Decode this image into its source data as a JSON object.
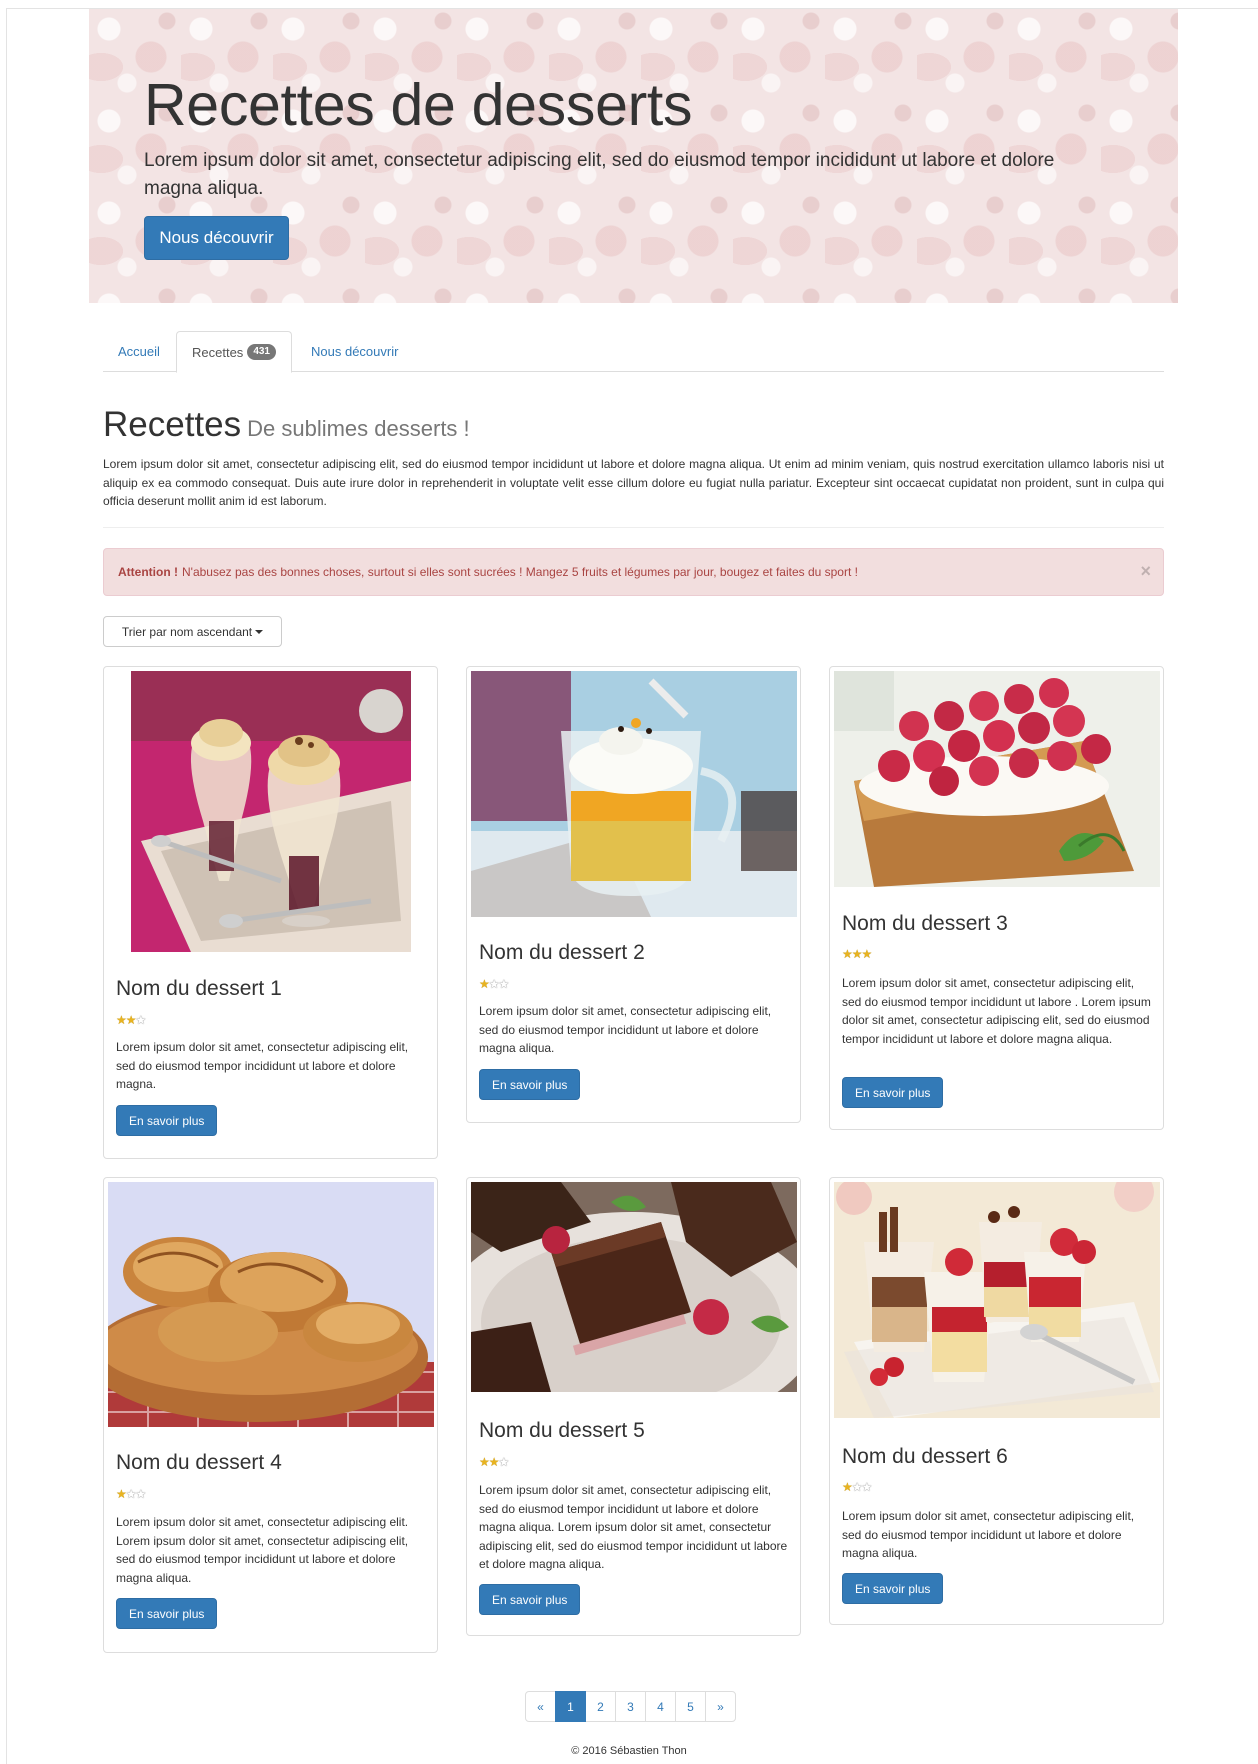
{
  "jumbotron": {
    "title": "Recettes de desserts",
    "lead": "Lorem ipsum dolor sit amet, consectetur adipiscing elit, sed do eiusmod tempor incididunt ut labore et dolore magna aliqua.",
    "button": "Nous découvrir"
  },
  "tabs": [
    {
      "label": "Accueil"
    },
    {
      "label": "Recettes",
      "badge": "431"
    },
    {
      "label": "Nous découvrir"
    }
  ],
  "section": {
    "title": "Recettes",
    "subtitle": "De sublimes desserts !",
    "intro": "Lorem ipsum dolor sit amet, consectetur adipiscing elit, sed do eiusmod tempor incididunt ut labore et dolore magna aliqua. Ut enim ad minim veniam, quis nostrud exercitation ullamco laboris nisi ut aliquip ex ea commodo consequat. Duis aute irure dolor in reprehenderit in voluptate velit esse cillum dolore eu fugiat nulla pariatur. Excepteur sint occaecat cupidatat non proident, sunt in culpa qui officia deserunt mollit anim id est laborum."
  },
  "alert": {
    "strong": "Attention !",
    "text": "N'abusez pas des bonnes choses, surtout si elles sont sucrées ! Mangez 5 fruits et légumes par jour, bougez et faites du sport !",
    "close": "×"
  },
  "sort": {
    "label": "Trier par nom ascendant"
  },
  "cards": [
    {
      "title": "Nom du dessert 1",
      "rating": 2,
      "max_rating": 3,
      "desc": "Lorem ipsum dolor sit amet, consectetur adipiscing elit, sed do eiusmod tempor incididunt ut labore et dolore magna.",
      "button": "En savoir plus",
      "image": "ice-cream-sundae-glasses"
    },
    {
      "title": "Nom du dessert 2",
      "rating": 1,
      "max_rating": 3,
      "desc": "Lorem ipsum dolor sit amet, consectetur adipiscing elit, sed do eiusmod tempor incididunt ut labore et dolore magna aliqua.",
      "button": "En savoir plus",
      "image": "mango-passion-fruit-verrine"
    },
    {
      "title": "Nom du dessert 3",
      "rating": 3,
      "max_rating": 3,
      "desc": "Lorem ipsum dolor sit amet, consectetur adipiscing elit, sed do eiusmod tempor incididunt ut labore . Lorem ipsum dolor sit amet, consectetur adipiscing elit, sed do eiusmod tempor incididunt ut labore et dolore magna aliqua.",
      "button": "En savoir plus",
      "image": "raspberry-tart"
    },
    {
      "title": "Nom du dessert 4",
      "rating": 1,
      "max_rating": 3,
      "desc": "Lorem ipsum dolor sit amet, consectetur adipiscing elit. Lorem ipsum dolor sit amet, consectetur adipiscing elit, sed do eiusmod tempor incididunt ut labore et dolore magna aliqua.",
      "button": "En savoir plus",
      "image": "croissants-basket"
    },
    {
      "title": "Nom du dessert 5",
      "rating": 2,
      "max_rating": 3,
      "desc": "Lorem ipsum dolor sit amet, consectetur adipiscing elit, sed do eiusmod tempor incididunt ut labore et dolore magna aliqua. Lorem ipsum dolor sit amet, consectetur adipiscing elit, sed do eiusmod tempor incididunt ut labore et dolore magna aliqua.",
      "button": "En savoir plus",
      "image": "chocolate-squares-raspberries"
    },
    {
      "title": "Nom du dessert 6",
      "rating": 1,
      "max_rating": 3,
      "desc": "Lorem ipsum dolor sit amet, consectetur adipiscing elit, sed do eiusmod tempor incididunt ut labore et dolore magna aliqua.",
      "button": "En savoir plus",
      "image": "strawberry-verrines"
    }
  ],
  "pagination": {
    "prev": "«",
    "pages": [
      "1",
      "2",
      "3",
      "4",
      "5"
    ],
    "active": "1",
    "next": "»"
  },
  "footer": {
    "text": "© 2016 Sébastien Thon"
  },
  "colors": {
    "primary": "#337ab7",
    "alert_bg": "#f2dede",
    "alert_text": "#a94442",
    "star": "#e8b320"
  }
}
